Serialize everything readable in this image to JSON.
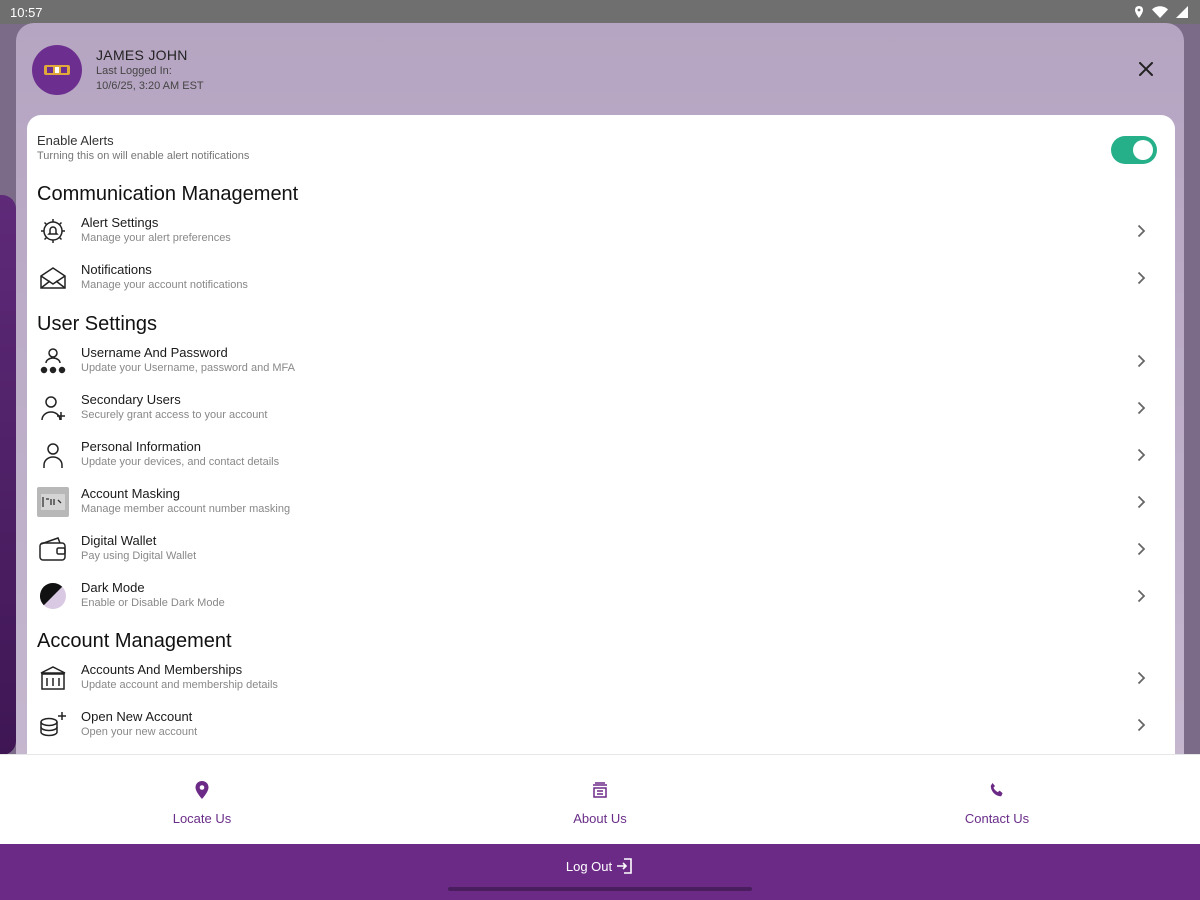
{
  "status_bar": {
    "time": "10:57"
  },
  "profile": {
    "name": "JAMES JOHN",
    "last_logged_label": "Last Logged In:",
    "last_logged_value": "10/6/25, 3:20 AM EST"
  },
  "alerts": {
    "title": "Enable Alerts",
    "subtitle": "Turning this on will enable alert notifications",
    "enabled": true
  },
  "sections": {
    "communication": {
      "title": "Communication Management",
      "items": [
        {
          "title": "Alert Settings",
          "subtitle": "Manage your alert preferences",
          "icon": "gear-bell-icon"
        },
        {
          "title": "Notifications",
          "subtitle": "Manage your account notifications",
          "icon": "envelope-icon"
        }
      ]
    },
    "user": {
      "title": "User Settings",
      "items": [
        {
          "title": "Username And Password",
          "subtitle": "Update your Username, password and MFA",
          "icon": "user-key-icon"
        },
        {
          "title": "Secondary Users",
          "subtitle": "Securely grant access to your account",
          "icon": "user-plus-icon"
        },
        {
          "title": "Personal Information",
          "subtitle": "Update your devices, and contact details",
          "icon": "user-icon"
        },
        {
          "title": "Account Masking",
          "subtitle": "Manage member account number masking",
          "icon": "mask-icon"
        },
        {
          "title": "Digital Wallet",
          "subtitle": "Pay using Digital Wallet",
          "icon": "wallet-icon"
        },
        {
          "title": "Dark Mode",
          "subtitle": "Enable or Disable Dark Mode",
          "icon": "dark-mode-icon"
        }
      ]
    },
    "account": {
      "title": "Account Management",
      "items": [
        {
          "title": "Accounts And Memberships",
          "subtitle": "Update account and membership details",
          "icon": "bank-icon"
        },
        {
          "title": "Open New Account",
          "subtitle": "Open your new account",
          "icon": "coins-plus-icon"
        }
      ]
    }
  },
  "bottom_nav": {
    "locate": "Locate Us",
    "about": "About Us",
    "contact": "Contact Us"
  },
  "logout": {
    "label": "Log Out"
  },
  "colors": {
    "brand_purple": "#6c2a87",
    "toggle_on": "#26b08a"
  }
}
